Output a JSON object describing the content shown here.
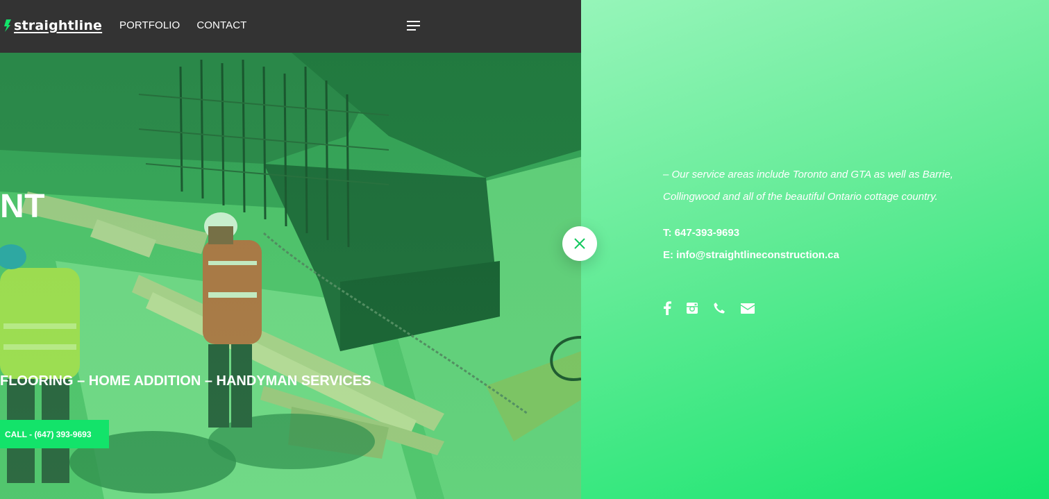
{
  "header": {
    "logo_text": "straightline",
    "nav": [
      {
        "label": "PORTFOLIO"
      },
      {
        "label": "CONTACT"
      }
    ]
  },
  "hero": {
    "headline_fragment": "NT",
    "services_line": "FLOORING – HOME ADDITION – HANDYMAN SERVICES",
    "call_button": "CALL - (647) 393-9693"
  },
  "panel": {
    "service_areas": "–  Our service areas include Toronto and GTA as well as Barrie, Collingwood and all of the beautiful Ontario cottage country.",
    "phone": "T: 647-393-9693",
    "email": "E: info@straightlineconstruction.ca",
    "social_icons": [
      "facebook-icon",
      "instagram-icon",
      "phone-icon",
      "envelope-icon"
    ]
  },
  "colors": {
    "header_bg": "#333333",
    "accent_green": "#13e36a",
    "panel_gradient_start": "#96f5b9",
    "panel_gradient_end": "#15e56d"
  }
}
